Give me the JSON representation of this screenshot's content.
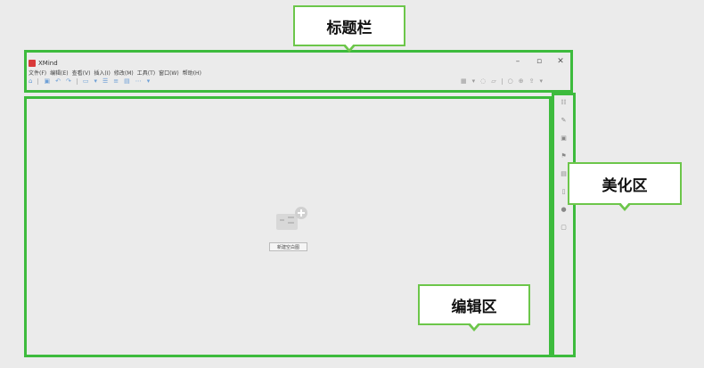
{
  "callouts": {
    "title_bar": "标题栏",
    "beauty_area": "美化区",
    "editor_area": "编辑区"
  },
  "app": {
    "name": "XMind",
    "window_controls": [
      "–",
      "▫",
      "✕"
    ]
  },
  "menu": [
    "文件(F)",
    "编辑(E)",
    "查看(V)",
    "插入(I)",
    "修改(M)",
    "工具(T)",
    "窗口(W)",
    "帮助(H)"
  ],
  "toolbar": {
    "left_icons": [
      "home-icon",
      "save-icon",
      "undo-icon",
      "redo-icon",
      "folder-icon",
      "dropdown-icon",
      "topic-icon",
      "subtopic-icon",
      "layout-icon",
      "more-icon",
      "dropdown-icon"
    ],
    "right_icons": [
      "insert-icon",
      "dropdown-icon",
      "idea-icon",
      "present-icon",
      "zoom-out-icon",
      "zoom-in-icon",
      "share-icon",
      "dropdown-icon"
    ]
  },
  "side_panel_icons": [
    "outline-icon",
    "format-icon",
    "picture-icon",
    "marker-icon",
    "image-icon",
    "notes-icon",
    "comment-icon",
    "task-icon"
  ],
  "editor": {
    "new_map_label": "新建空白图"
  },
  "colors": {
    "annotation": "#3dbb3d",
    "logo": "#d93a3a",
    "toolbar_icon": "#6d9fd6"
  }
}
